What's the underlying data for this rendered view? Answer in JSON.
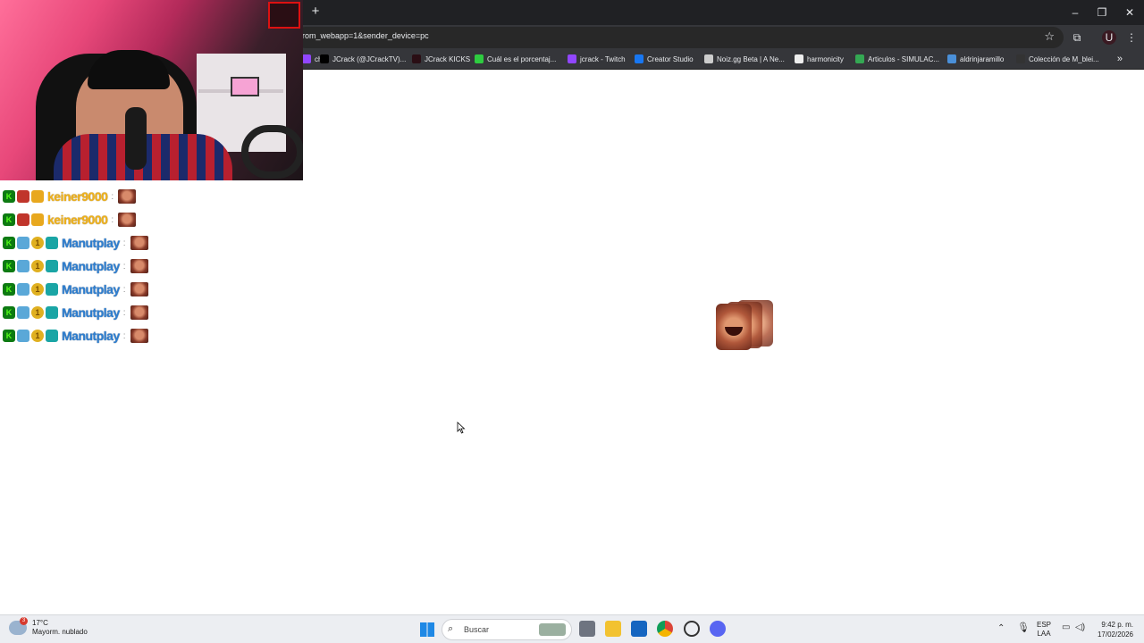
{
  "browser": {
    "new_tab": "+",
    "url": "rom_webapp=1&sender_device=pc",
    "window_controls": {
      "minimize": "–",
      "maximize": "❐",
      "close": "✕"
    },
    "icons": {
      "star": "star-icon",
      "extensions": "puzzle-icon",
      "profile": "profile-icon",
      "menu": "kebab-menu-icon"
    },
    "bookmarks": [
      {
        "label": "ch",
        "color": "#9146ff"
      },
      {
        "label": "JCrack (@JCrackTV)...",
        "color": "#000000"
      },
      {
        "label": "JCrack KICKS",
        "color": "#2a0e14"
      },
      {
        "label": "Cuál es el porcentaj...",
        "color": "#2ecc40"
      },
      {
        "label": "jcrack - Twitch",
        "color": "#9146ff"
      },
      {
        "label": "Creator Studio",
        "color": "#1877f2"
      },
      {
        "label": "Noiz.gg Beta | A Ne...",
        "color": "#cccccc"
      },
      {
        "label": "harmonicity",
        "color": "#eeeeee"
      },
      {
        "label": "Articulos - SIMULAC...",
        "color": "#34a853"
      },
      {
        "label": "aldrinjaramillo",
        "color": "#4a90d9"
      },
      {
        "label": "Colección de M_blei...",
        "color": "#333333"
      }
    ],
    "more": "»"
  },
  "chat": {
    "messages": [
      {
        "user": "keiner9000",
        "color": "gold",
        "badges": [
          "kick",
          "red",
          "crown"
        ]
      },
      {
        "user": "keiner9000",
        "color": "gold",
        "badges": [
          "kick",
          "red",
          "crown"
        ]
      },
      {
        "user": "Manutplay",
        "color": "blue",
        "badges": [
          "kick",
          "sub",
          "coin",
          "teal"
        ]
      },
      {
        "user": "Manutplay",
        "color": "blue",
        "badges": [
          "kick",
          "sub",
          "coin",
          "teal"
        ]
      },
      {
        "user": "Manutplay",
        "color": "blue",
        "badges": [
          "kick",
          "sub",
          "coin",
          "teal"
        ]
      },
      {
        "user": "Manutplay",
        "color": "blue",
        "badges": [
          "kick",
          "sub",
          "coin",
          "teal"
        ]
      },
      {
        "user": "Manutplay",
        "color": "blue",
        "badges": [
          "kick",
          "sub",
          "coin",
          "teal"
        ]
      }
    ],
    "separator": ":"
  },
  "taskbar": {
    "weather": {
      "temp": "17°C",
      "condition": "Mayorm. nublado",
      "badge": "3"
    },
    "search_placeholder": "Buscar",
    "apps": [
      "file-explorer-icon",
      "folder-icon",
      "outlook-icon",
      "chrome-icon",
      "steam-icon",
      "discord-icon"
    ],
    "language": {
      "line1": "ESP",
      "line2": "LAA"
    },
    "clock": {
      "time": "9:42 p. m.",
      "date": "17/02/2026"
    }
  }
}
